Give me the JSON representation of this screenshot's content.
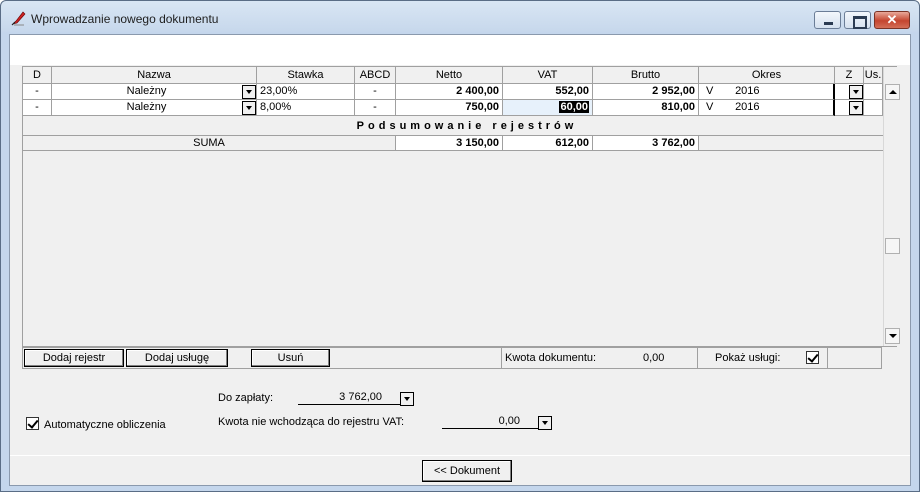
{
  "window": {
    "title": "Wprowadzanie nowego dokumentu"
  },
  "columns": [
    "D",
    "Nazwa",
    "Stawka",
    "ABCD",
    "Netto",
    "VAT",
    "Brutto",
    "Okres",
    "Z",
    "Us."
  ],
  "rows": [
    {
      "d": "-",
      "nazwa": "Należny",
      "stawka": "23,00%",
      "abcd": "-",
      "netto": "2 400,00",
      "vat": "552,00",
      "brutto": "2 952,00",
      "okres_v": "V",
      "okres_rok": "2016"
    },
    {
      "d": "-",
      "nazwa": "Należny",
      "stawka": "8,00%",
      "abcd": "-",
      "netto": "750,00",
      "vat": "60,00",
      "brutto": "810,00",
      "okres_v": "V",
      "okres_rok": "2016"
    }
  ],
  "summary": {
    "title": "Podsumowanie rejestrów",
    "label": "SUMA",
    "netto": "3 150,00",
    "vat": "612,00",
    "brutto": "3 762,00"
  },
  "toolbar": {
    "add_register": "Dodaj rejestr",
    "add_service": "Dodaj usługę",
    "delete": "Usuń",
    "doc_amount_label": "Kwota dokumentu:",
    "doc_amount_value": "0,00",
    "show_services_label": "Pokaż usługi:",
    "show_services_checked": true
  },
  "form": {
    "to_pay_label": "Do zapłaty:",
    "to_pay_value": "3 762,00",
    "auto_calc_label": "Automatyczne obliczenia",
    "auto_calc_checked": true,
    "not_vat_label": "Kwota nie wchodząca do rejestru VAT:",
    "not_vat_value": "0,00"
  },
  "footer": {
    "document_button": "<< Dokument"
  }
}
